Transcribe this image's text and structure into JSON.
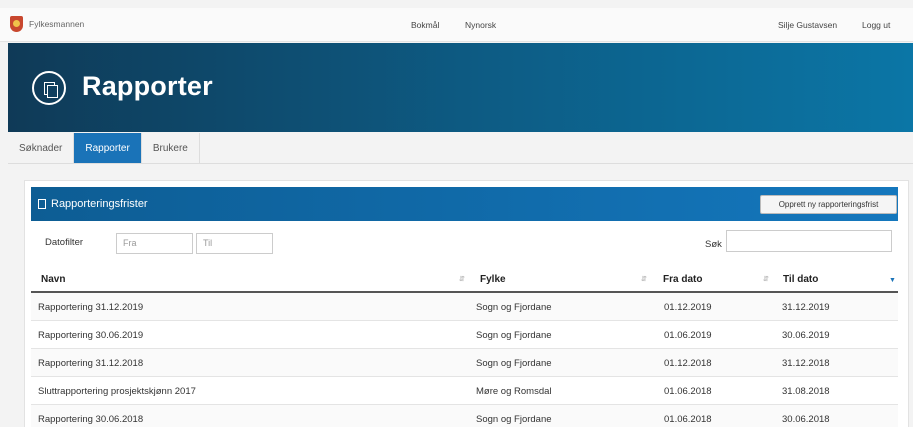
{
  "topbar": {
    "brand": "Fylkesmannen",
    "lang_nb": "Bokmål",
    "lang_nn": "Nynorsk",
    "user": "Silje Gustavsen",
    "logout": "Logg ut"
  },
  "hero": {
    "title": "Rapporter"
  },
  "tabs": [
    {
      "label": "Søknader"
    },
    {
      "label": "Rapporter",
      "active": true
    },
    {
      "label": "Brukere"
    }
  ],
  "panel": {
    "title": "Rapporteringsfrister",
    "new_button": "Opprett ny rapporteringsfrist",
    "filter_label": "Datofilter",
    "from_placeholder": "Fra",
    "to_placeholder": "Til",
    "search_label": "Søk"
  },
  "table": {
    "columns": [
      "Navn",
      "Fylke",
      "Fra dato",
      "Til dato"
    ],
    "rows": [
      [
        "Rapportering 31.12.2019",
        "Sogn og Fjordane",
        "01.12.2019",
        "31.12.2019"
      ],
      [
        "Rapportering 30.06.2019",
        "Sogn og Fjordane",
        "01.06.2019",
        "30.06.2019"
      ],
      [
        "Rapportering 31.12.2018",
        "Sogn og Fjordane",
        "01.12.2018",
        "31.12.2018"
      ],
      [
        "Sluttrapportering prosjektskjønn 2017",
        "Møre og Romsdal",
        "01.06.2018",
        "31.08.2018"
      ],
      [
        "Rapportering 30.06.2018",
        "Sogn og Fjordane",
        "01.06.2018",
        "30.06.2018"
      ]
    ]
  },
  "colors": {
    "header_dark": "#0f3a57",
    "accent": "#1a73b8"
  }
}
